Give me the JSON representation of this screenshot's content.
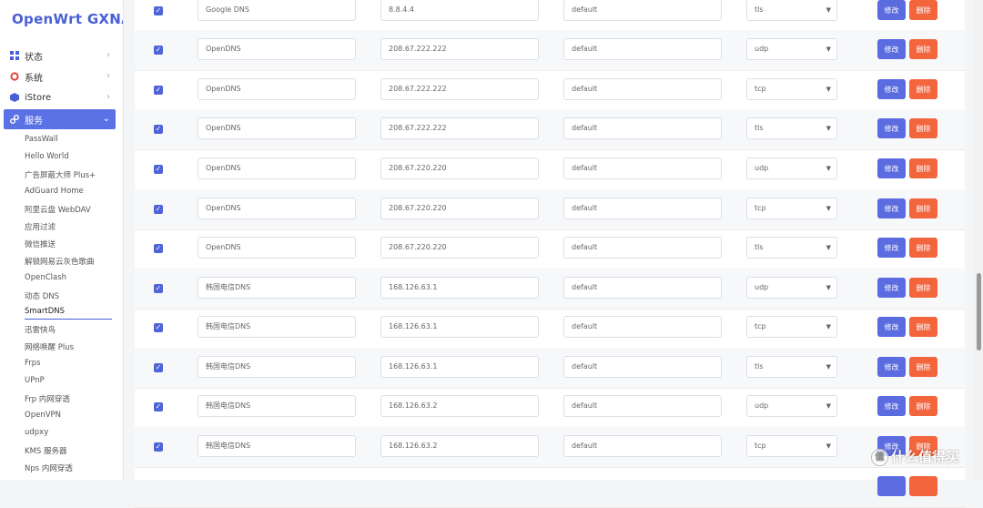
{
  "brand": "OpenWrt GXNAS",
  "menu": {
    "status": "状态",
    "system": "系统",
    "istore": "iStore",
    "services": "服务"
  },
  "services_submenu": [
    "PassWall",
    "Hello World",
    "广告屏蔽大师 Plus+",
    "AdGuard Home",
    "阿里云盘 WebDAV",
    "应用过滤",
    "微信推送",
    "解锁网易云灰色歌曲",
    "OpenClash",
    "动态 DNS",
    "SmartDNS",
    "迅雷快鸟",
    "网络唤醒 Plus",
    "Frps",
    "UPnP",
    "Frp 内网穿透",
    "OpenVPN",
    "udpxy",
    "KMS 服务器",
    "Nps 内网穿透"
  ],
  "active_submenu": "SmartDNS",
  "buttons": {
    "edit": "修改",
    "delete": "删除"
  },
  "servers": [
    {
      "name": "Google DNS",
      "ip": "8.8.4.4",
      "group": "default",
      "protocol": "tls"
    },
    {
      "name": "OpenDNS",
      "ip": "208.67.222.222",
      "group": "default",
      "protocol": "udp"
    },
    {
      "name": "OpenDNS",
      "ip": "208.67.222.222",
      "group": "default",
      "protocol": "tcp"
    },
    {
      "name": "OpenDNS",
      "ip": "208.67.222.222",
      "group": "default",
      "protocol": "tls"
    },
    {
      "name": "OpenDNS",
      "ip": "208.67.220.220",
      "group": "default",
      "protocol": "udp"
    },
    {
      "name": "OpenDNS",
      "ip": "208.67.220.220",
      "group": "default",
      "protocol": "tcp"
    },
    {
      "name": "OpenDNS",
      "ip": "208.67.220.220",
      "group": "default",
      "protocol": "tls"
    },
    {
      "name": "韩国电信DNS",
      "ip": "168.126.63.1",
      "group": "default",
      "protocol": "udp"
    },
    {
      "name": "韩国电信DNS",
      "ip": "168.126.63.1",
      "group": "default",
      "protocol": "tcp"
    },
    {
      "name": "韩国电信DNS",
      "ip": "168.126.63.1",
      "group": "default",
      "protocol": "tls"
    },
    {
      "name": "韩国电信DNS",
      "ip": "168.126.63.2",
      "group": "default",
      "protocol": "udp"
    },
    {
      "name": "韩国电信DNS",
      "ip": "168.126.63.2",
      "group": "default",
      "protocol": "tcp"
    }
  ],
  "watermark": "值 什么值得买",
  "colors": {
    "accent": "#5b72e6",
    "edit": "#5b6be0",
    "delete": "#f2653d",
    "checkbox": "#4f64d9"
  }
}
